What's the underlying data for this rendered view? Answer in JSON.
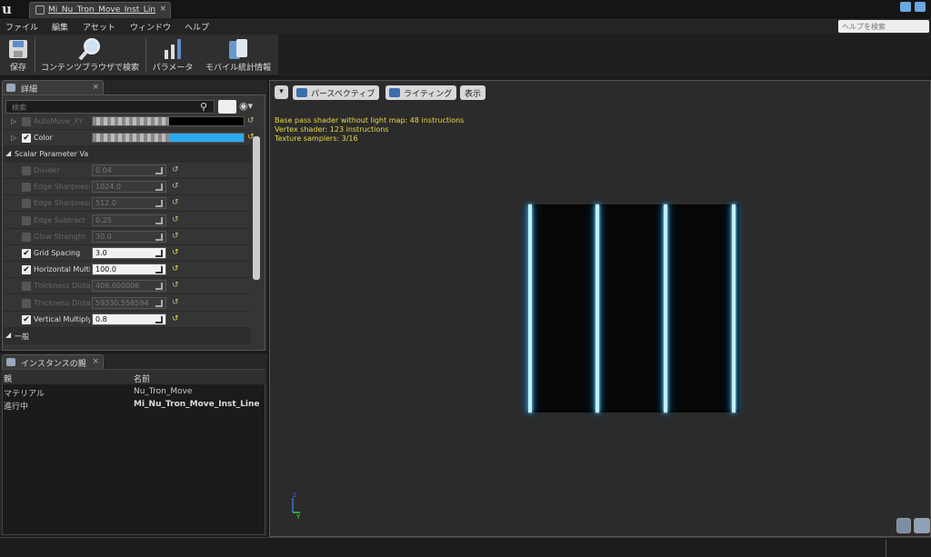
{
  "window": {
    "tab_title": "Mi_Nu_Tron_Move_Inst_Lin",
    "tab_close": "×"
  },
  "menu": [
    "ファイル",
    "編集",
    "アセット",
    "ウィンドウ",
    "ヘルプ"
  ],
  "help_search_placeholder": "ヘルプを検索",
  "toolbar": {
    "save": "保存",
    "browse": "コンテンツブラウザで検索",
    "params": "パラメータ",
    "mobile_stats": "モバイル統計情報"
  },
  "details": {
    "tab": "詳細",
    "search_placeholder": "検索",
    "vector_rows": [
      {
        "name": "AutoMove_XY",
        "checked": false,
        "color": "#000000"
      },
      {
        "name": "Color",
        "checked": true,
        "color": "#2ea9ee"
      }
    ],
    "scalar_category": "Scalar Parameter Va",
    "scalar_rows": [
      {
        "name": "Divider",
        "value": "0.04",
        "checked": false
      },
      {
        "name": "Edge Sharpness",
        "value": "1024.0",
        "checked": false
      },
      {
        "name": "Edge Sharpness",
        "value": "512.0",
        "checked": false
      },
      {
        "name": "Edge Subtract",
        "value": "0.25",
        "checked": false
      },
      {
        "name": "Glow Strength",
        "value": "30.0",
        "checked": false
      },
      {
        "name": "Grid Spacing",
        "value": "3.0",
        "checked": true
      },
      {
        "name": "Horizontal Multi",
        "value": "100.0",
        "checked": true
      },
      {
        "name": "Thickness Dista",
        "value": "408.600006",
        "checked": false
      },
      {
        "name": "Thickness Dista",
        "value": "59330.558594",
        "checked": false
      },
      {
        "name": "Vertical Multiply",
        "value": "0.8",
        "checked": true
      }
    ],
    "general_category": "一般"
  },
  "instance": {
    "tab": "インスタンスの親",
    "col_parent": "親",
    "col_name": "名前",
    "rows": [
      {
        "label": "マテリアル",
        "name": "Nu_Tron_Move",
        "bold": false
      },
      {
        "label": "進行中",
        "name": "Mi_Nu_Tron_Move_Inst_Line",
        "bold": true
      }
    ]
  },
  "viewport": {
    "perspective": "パースペクティブ",
    "lighting": "ライティング",
    "show": "表示",
    "stats": [
      "Base pass shader without light map: 48 instructions",
      "Vertex shader: 123 instructions",
      "Texture samplers: 3/16"
    ],
    "axis_z": "Z",
    "axis_y": "Y"
  }
}
